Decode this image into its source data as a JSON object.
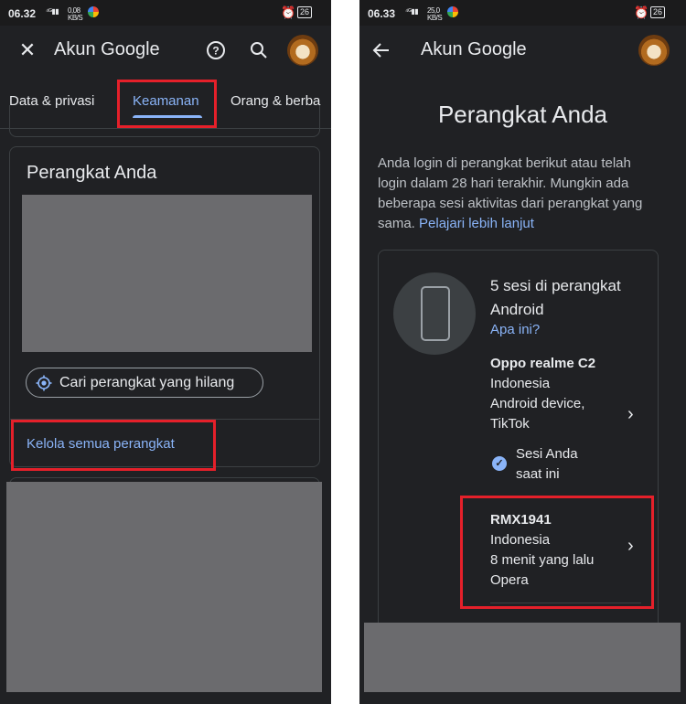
{
  "left": {
    "status": {
      "time": "06.32",
      "net": "0,08 KB/S",
      "battery": "26"
    },
    "title": "Akun Google",
    "tabs": [
      "Data & privasi",
      "Keamanan",
      "Orang & berba"
    ],
    "card_title": "Perangkat Anda",
    "find_chip": "Cari perangkat yang hilang",
    "manage_link": "Kelola semua perangkat"
  },
  "right": {
    "status": {
      "time": "06.33",
      "net": "25,0 KB/S",
      "battery": "26"
    },
    "title": "Akun Google",
    "heading": "Perangkat Anda",
    "intro": "Anda login di perangkat berikut atau telah login dalam 28 hari terakhir. Mungkin ada beberapa sesi aktivitas dari perangkat yang sama.",
    "learn_more": "Pelajari lebih lanjut",
    "group_title": "5 sesi di perangkat Android",
    "group_help": "Apa ini?",
    "device1": {
      "name": "Oppo realme C2",
      "location": "Indonesia",
      "detail1": "Android device,",
      "detail2": "TikTok",
      "current_session": "Sesi Anda saat ini"
    },
    "device2": {
      "name": "RMX1941",
      "location": "Indonesia",
      "time": "8 menit yang lalu",
      "app": "Opera"
    }
  },
  "colors": {
    "background": "#202124",
    "accent": "#8ab4f8",
    "highlight": "#e5202a",
    "redaction": "#6b6b6e"
  }
}
